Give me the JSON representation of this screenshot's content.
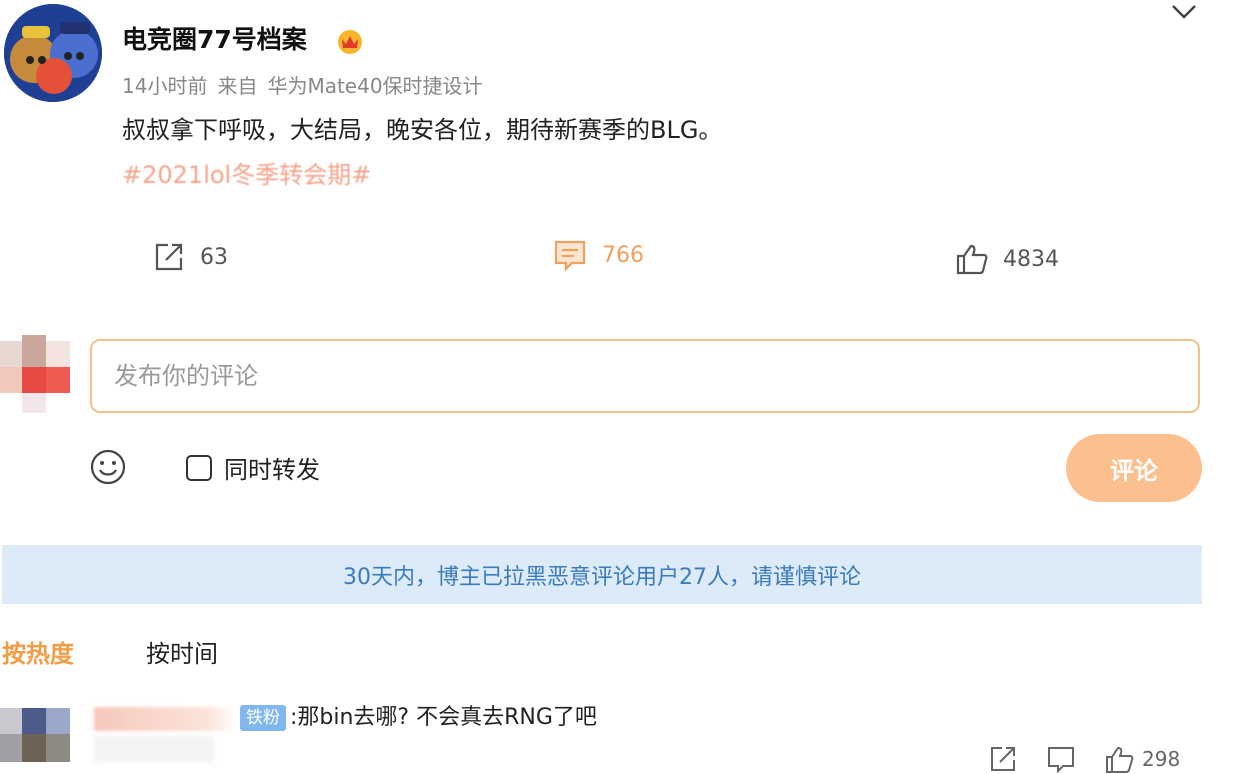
{
  "post": {
    "author": "电竞圈77号档案",
    "time": "14小时前",
    "source_prefix": "来自",
    "source": "华为Mate40保时捷设计",
    "text": "叔叔拿下呼吸，大结局，晚安各位，期待新赛季的BLG。",
    "hashtag": "#2021lol冬季转会期#"
  },
  "actions": {
    "repost_count": "63",
    "comment_count": "766",
    "like_count": "4834"
  },
  "composer": {
    "placeholder": "发布你的评论",
    "repost_label": "同时转发",
    "submit_label": "评论"
  },
  "notice": "30天内，博主已拉黑恶意评论用户27人，请谨慎评论",
  "sort": {
    "hot_label": "按热度",
    "time_label": "按时间"
  },
  "comments": [
    {
      "badge": "铁粉",
      "text": ":那bin去哪? 不会真去RNG了吧",
      "like_count": "298"
    }
  ],
  "colors": {
    "accent": "#f39c46",
    "hashtag": "#f6a48a",
    "input_border": "#f3c089",
    "notice_bg": "#dcebf7",
    "notice_text": "#3a7bbd"
  },
  "icons": [
    "chevron-down-icon",
    "repost-icon",
    "comment-icon",
    "like-icon",
    "smile-icon",
    "checkbox-icon"
  ]
}
